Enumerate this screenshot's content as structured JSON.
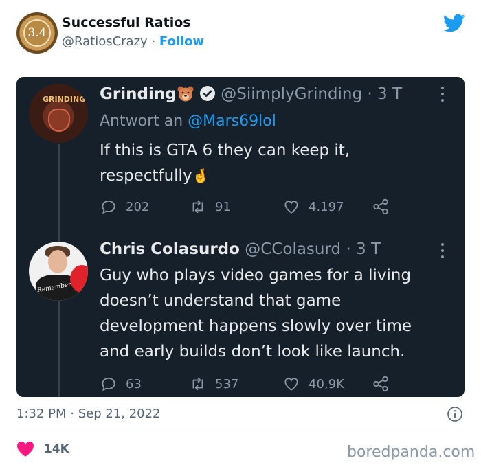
{
  "account": {
    "avatar_text": "3.4",
    "name": "Successful Ratios",
    "handle": "@RatiosCrazy",
    "separator": "·",
    "follow_label": "Follow"
  },
  "screenshot": {
    "tweet1": {
      "avatar_text": "GRINDING",
      "name": "Grinding",
      "handle": "@SiimplyGrinding",
      "time": "· 3 T",
      "reply_prefix": "Antwort an",
      "reply_mention": "@Mars69lol",
      "text_line1": "If this is GTA 6 they can keep it,",
      "text_line2": "respectfully",
      "emoji": "🤞",
      "replies": "202",
      "retweets": "91",
      "likes": "4.197"
    },
    "tweet2": {
      "avatar_text": "Remember",
      "name": "Chris Colasurdo",
      "handle": "@CColasurd",
      "time": "· 3 T",
      "lines": [
        "Guy who plays video games for a living",
        "doesn’t understand that game",
        "development happens slowly over time",
        "and early builds don’t look like launch."
      ],
      "replies": "63",
      "retweets": "537",
      "likes": "40,9K"
    }
  },
  "footer": {
    "timestamp": "1:32 PM · Sep 21, 2022",
    "likes": "14K",
    "watermark": "boredpanda.com"
  },
  "colors": {
    "accent": "#1d9bf0",
    "dark_bg": "#15202b",
    "heart": "#f91880"
  },
  "icons": [
    "twitter-bird-icon",
    "verified-badge-icon",
    "bear-emoji-icon",
    "crossed-fingers-emoji-icon",
    "more-icon",
    "reply-icon",
    "retweet-icon",
    "like-icon",
    "share-icon",
    "info-icon",
    "heart-icon"
  ]
}
